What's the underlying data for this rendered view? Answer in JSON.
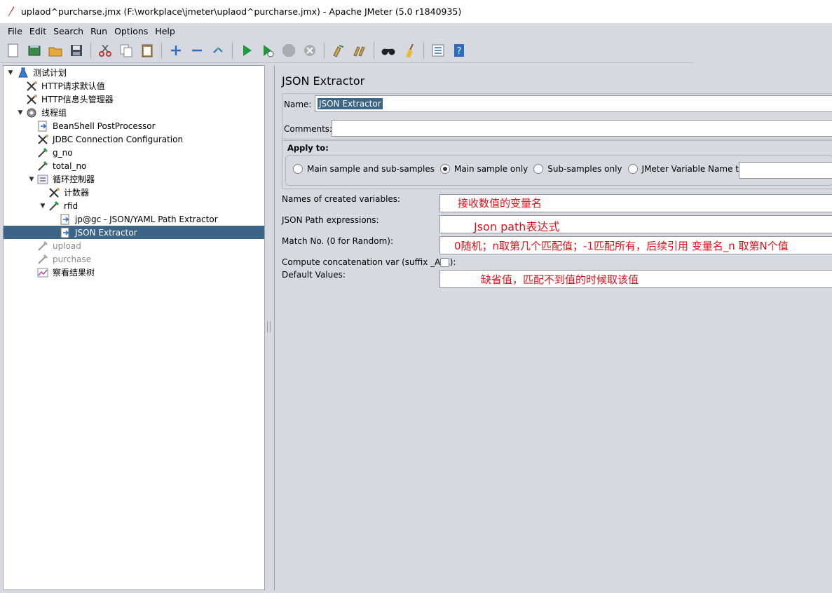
{
  "window": {
    "title": "uplaod^purcharse.jmx (F:\\workplace\\jmeter\\uplaod^purcharse.jmx) - Apache JMeter (5.0 r1840935)"
  },
  "menu": [
    "File",
    "Edit",
    "Search",
    "Run",
    "Options",
    "Help"
  ],
  "toolbar": [
    "new-icon",
    "templates-icon",
    "open-icon",
    "save-icon",
    "cut-icon",
    "copy-icon",
    "paste-icon",
    "expand-icon",
    "collapse-icon",
    "toggle-icon",
    "start-icon",
    "start-no-pause-icon",
    "stop-icon",
    "shutdown-icon",
    "clear-icon",
    "clear-all-icon",
    "search-icon",
    "reset-search-icon",
    "function-helper-icon",
    "help-icon"
  ],
  "tree": [
    {
      "label": "测试计划"
    },
    {
      "label": "HTTP请求默认值"
    },
    {
      "label": "HTTP信息头管理器"
    },
    {
      "label": "线程组"
    },
    {
      "label": "BeanShell PostProcessor"
    },
    {
      "label": "JDBC Connection Configuration"
    },
    {
      "label": "g_no"
    },
    {
      "label": "total_no"
    },
    {
      "label": "循环控制器"
    },
    {
      "label": "计数器"
    },
    {
      "label": "rfid"
    },
    {
      "label": "jp@gc - JSON/YAML Path Extractor"
    },
    {
      "label": "JSON Extractor"
    },
    {
      "label": "upload"
    },
    {
      "label": "purchase"
    },
    {
      "label": "察看结果树"
    }
  ],
  "panel": {
    "title": "JSON Extractor",
    "name_label": "Name:",
    "name_value": "JSON Extractor",
    "comments_label": "Comments:",
    "apply_to_label": "Apply to:",
    "radio_options": [
      "Main sample and sub-samples",
      "Main sample only",
      "Sub-samples only",
      "JMeter Variable Name to use"
    ],
    "radio_selected": "Main sample only",
    "fields": [
      {
        "label": "Names of created variables:",
        "note": "接收数值的变量名"
      },
      {
        "label": "JSON Path expressions:",
        "note": "Json path表达式"
      },
      {
        "label": "Match No. (0 for Random):",
        "note": "0随机；n取第几个匹配值；-1匹配所有，后续引用 变量名_n 取第N个值"
      },
      {
        "label": "Compute concatenation var (suffix _ALL):",
        "note": ""
      },
      {
        "label": "Default Values:",
        "note": "缺省值，匹配不到值的时候取该值"
      }
    ]
  },
  "colors": {
    "selection": "#3c6486",
    "annotation": "#e0101a",
    "background": "#d6d9df"
  }
}
